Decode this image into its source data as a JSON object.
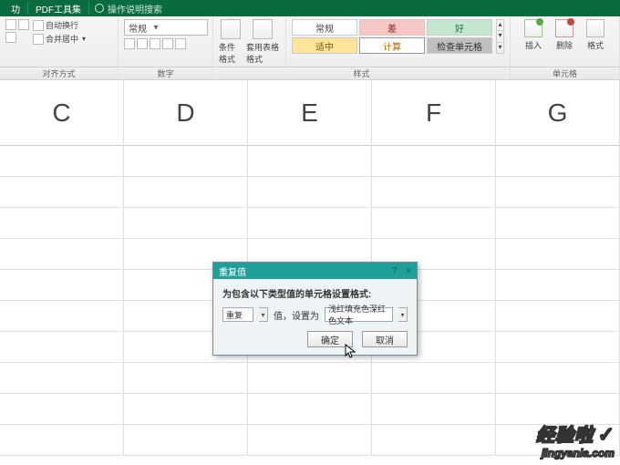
{
  "top_tabs": {
    "tab1": "功",
    "tab2": "PDF工具集",
    "search_placeholder": "操作说明搜索"
  },
  "ribbon": {
    "align": {
      "wrap": "自动换行",
      "merge": "合并居中",
      "group_label": "对齐方式"
    },
    "number": {
      "format_selected": "常规",
      "group_label": "数字"
    },
    "cond": {
      "btn1": "条件格式",
      "btn2": "套用表格格式"
    },
    "styles": {
      "normal": "常规",
      "bad": "差",
      "good": "好",
      "mid": "适中",
      "calc": "计算",
      "check": "检查单元格",
      "group_label": "样式"
    },
    "cells": {
      "insert": "插入",
      "delete": "删除",
      "format": "格式",
      "group_label": "单元格"
    }
  },
  "columns": [
    "C",
    "D",
    "E",
    "F",
    "G"
  ],
  "dialog": {
    "title": "重复值",
    "help": "?",
    "close": "×",
    "heading": "为包含以下类型值的单元格设置格式:",
    "dup_label": "重复",
    "value_prefix": "值，设置为",
    "format_selected": "浅红填充色深红色文本",
    "ok": "确定",
    "cancel": "取消"
  },
  "watermark": {
    "line1": "经验啦",
    "line2": "jingyanla.com"
  }
}
